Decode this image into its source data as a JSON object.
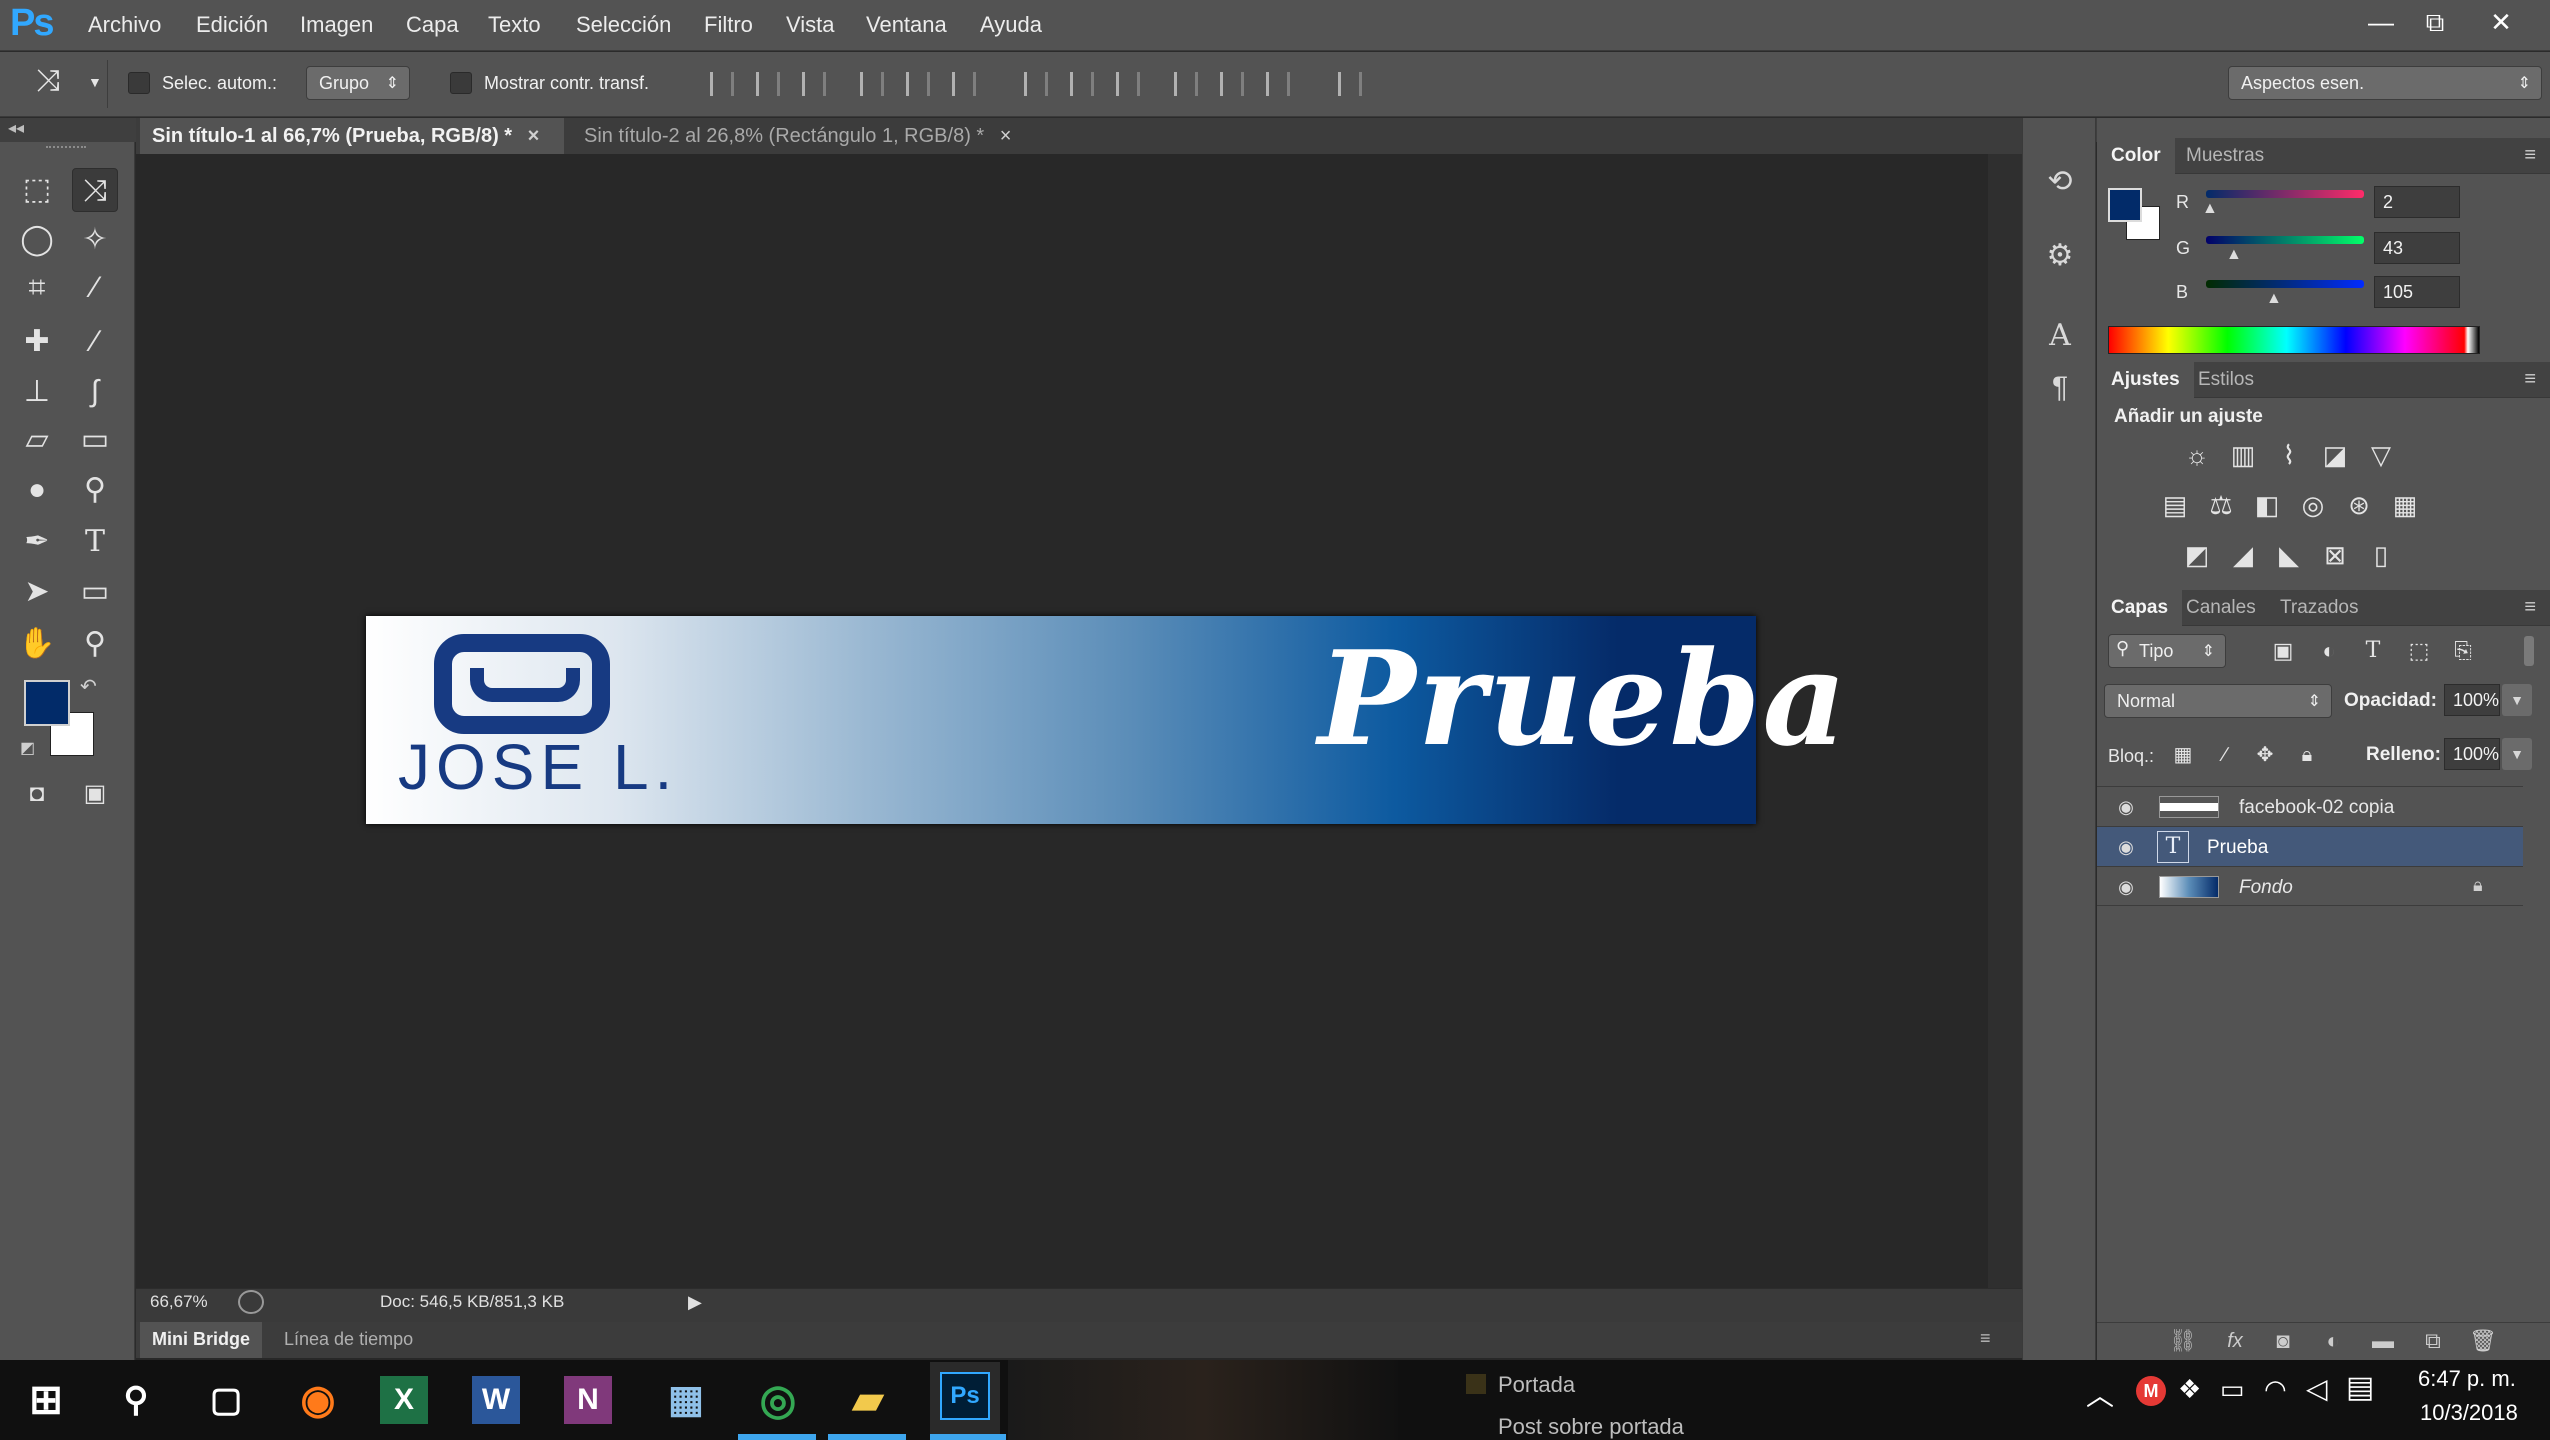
{
  "app": {
    "logo": "Ps"
  },
  "menu": [
    "Archivo",
    "Edición",
    "Imagen",
    "Capa",
    "Texto",
    "Selección",
    "Filtro",
    "Vista",
    "Ventana",
    "Ayuda"
  ],
  "window_controls": {
    "minimize": "—",
    "restore": "⧉",
    "close": "✕"
  },
  "options": {
    "auto_select_label": "Selec. autom.:",
    "auto_select_value": "Grupo",
    "show_transform_label": "Mostrar contr. transf.",
    "workspace": "Aspectos esen."
  },
  "doc_tabs": [
    {
      "label": "Sin título-1 al 66,7% (Prueba, RGB/8) *",
      "close": "×"
    },
    {
      "label": "Sin título-2 al 26,8% (Rectángulo 1, RGB/8) *",
      "close": "×"
    }
  ],
  "canvas": {
    "logo_text": "JOSE L.",
    "script_text": "Prueba"
  },
  "status": {
    "zoom": "66,67%",
    "doc_size": "Doc: 546,5 KB/851,3 KB"
  },
  "bottom_tabs": [
    "Mini Bridge",
    "Línea de tiempo"
  ],
  "color_panel": {
    "tabs": [
      "Color",
      "Muestras"
    ],
    "foreground": "#022b69",
    "background": "#ffffff",
    "channels": [
      {
        "label": "R",
        "value": "2"
      },
      {
        "label": "G",
        "value": "43"
      },
      {
        "label": "B",
        "value": "105"
      }
    ]
  },
  "adjust_panel": {
    "tabs": [
      "Ajustes",
      "Estilos"
    ],
    "heading": "Añadir un ajuste"
  },
  "layers_panel": {
    "tabs": [
      "Capas",
      "Canales",
      "Trazados"
    ],
    "filter_kind": "Tipo",
    "blend_mode": "Normal",
    "opacity_label": "Opacidad:",
    "opacity": "100%",
    "lock_label": "Bloq.:",
    "fill_label": "Relleno:",
    "fill": "100%",
    "layers": [
      {
        "name": "facebook-02 copia",
        "selected": false
      },
      {
        "name": "Prueba",
        "selected": true
      },
      {
        "name": "Fondo",
        "selected": false
      }
    ]
  },
  "taskbar": {
    "peek": [
      "Portada",
      "Post sobre portada"
    ],
    "time": "6:47 p. m.",
    "date": "10/3/2018"
  }
}
